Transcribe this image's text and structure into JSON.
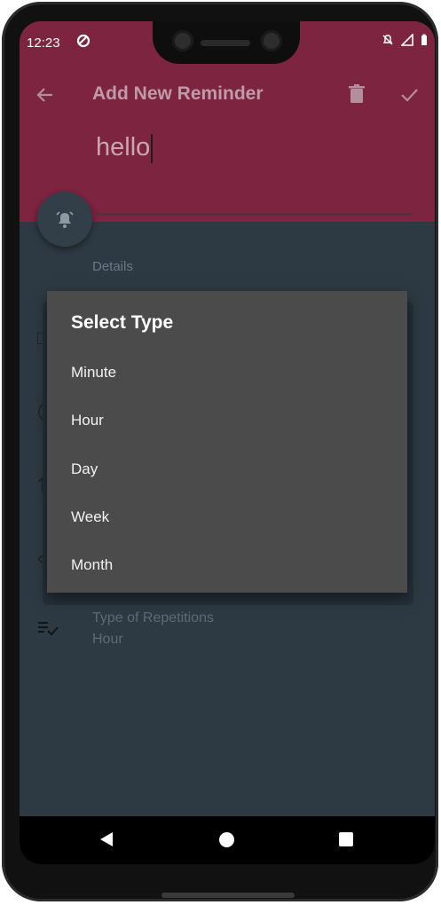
{
  "status_bar": {
    "time": "12:23",
    "icons": [
      "sync-icon",
      "notifications-off-icon",
      "signal-icon",
      "battery-icon"
    ]
  },
  "app_bar": {
    "title": "Add New Reminder",
    "back_icon": "arrow-back-icon",
    "delete_icon": "trash-icon",
    "confirm_icon": "check-icon"
  },
  "reminder": {
    "text_value": "hello"
  },
  "details": {
    "label": "Details",
    "repetition_type_label": "Type of Repetitions",
    "repetition_type_value": "Hour"
  },
  "dialog": {
    "title": "Select Type",
    "options": [
      "Minute",
      "Hour",
      "Day",
      "Week",
      "Month"
    ]
  },
  "colors": {
    "header": "#7d2440",
    "screen_bg": "#2e3a43",
    "dialog_bg": "#4b4b4b"
  }
}
